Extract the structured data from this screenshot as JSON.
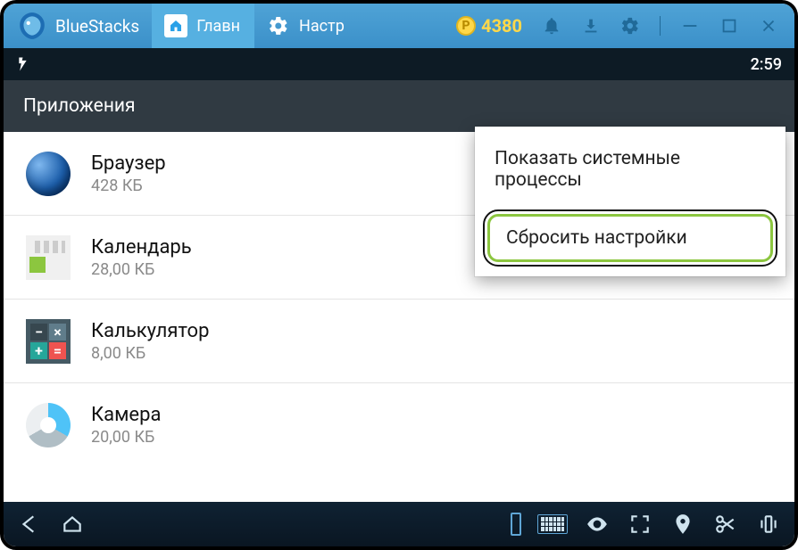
{
  "titlebar": {
    "brand": "BlueStacks",
    "tabs": [
      {
        "label": "Главн",
        "icon": "home-icon"
      },
      {
        "label": "Настр",
        "icon": "gear-icon"
      }
    ],
    "coins": "4380"
  },
  "status": {
    "time": "2:59"
  },
  "header": {
    "title": "Приложения"
  },
  "popup": {
    "items": [
      {
        "label": "Показать системные процессы",
        "highlight": false
      },
      {
        "label": "Сбросить настройки",
        "highlight": true
      }
    ]
  },
  "apps": [
    {
      "name": "Браузер",
      "size": "428 КБ",
      "icon": "browser"
    },
    {
      "name": "Календарь",
      "size": "28,00 КБ",
      "icon": "calendar"
    },
    {
      "name": "Калькулятор",
      "size": "8,00 КБ",
      "icon": "calculator"
    },
    {
      "name": "Камера",
      "size": "20,00 КБ",
      "icon": "camera"
    }
  ]
}
